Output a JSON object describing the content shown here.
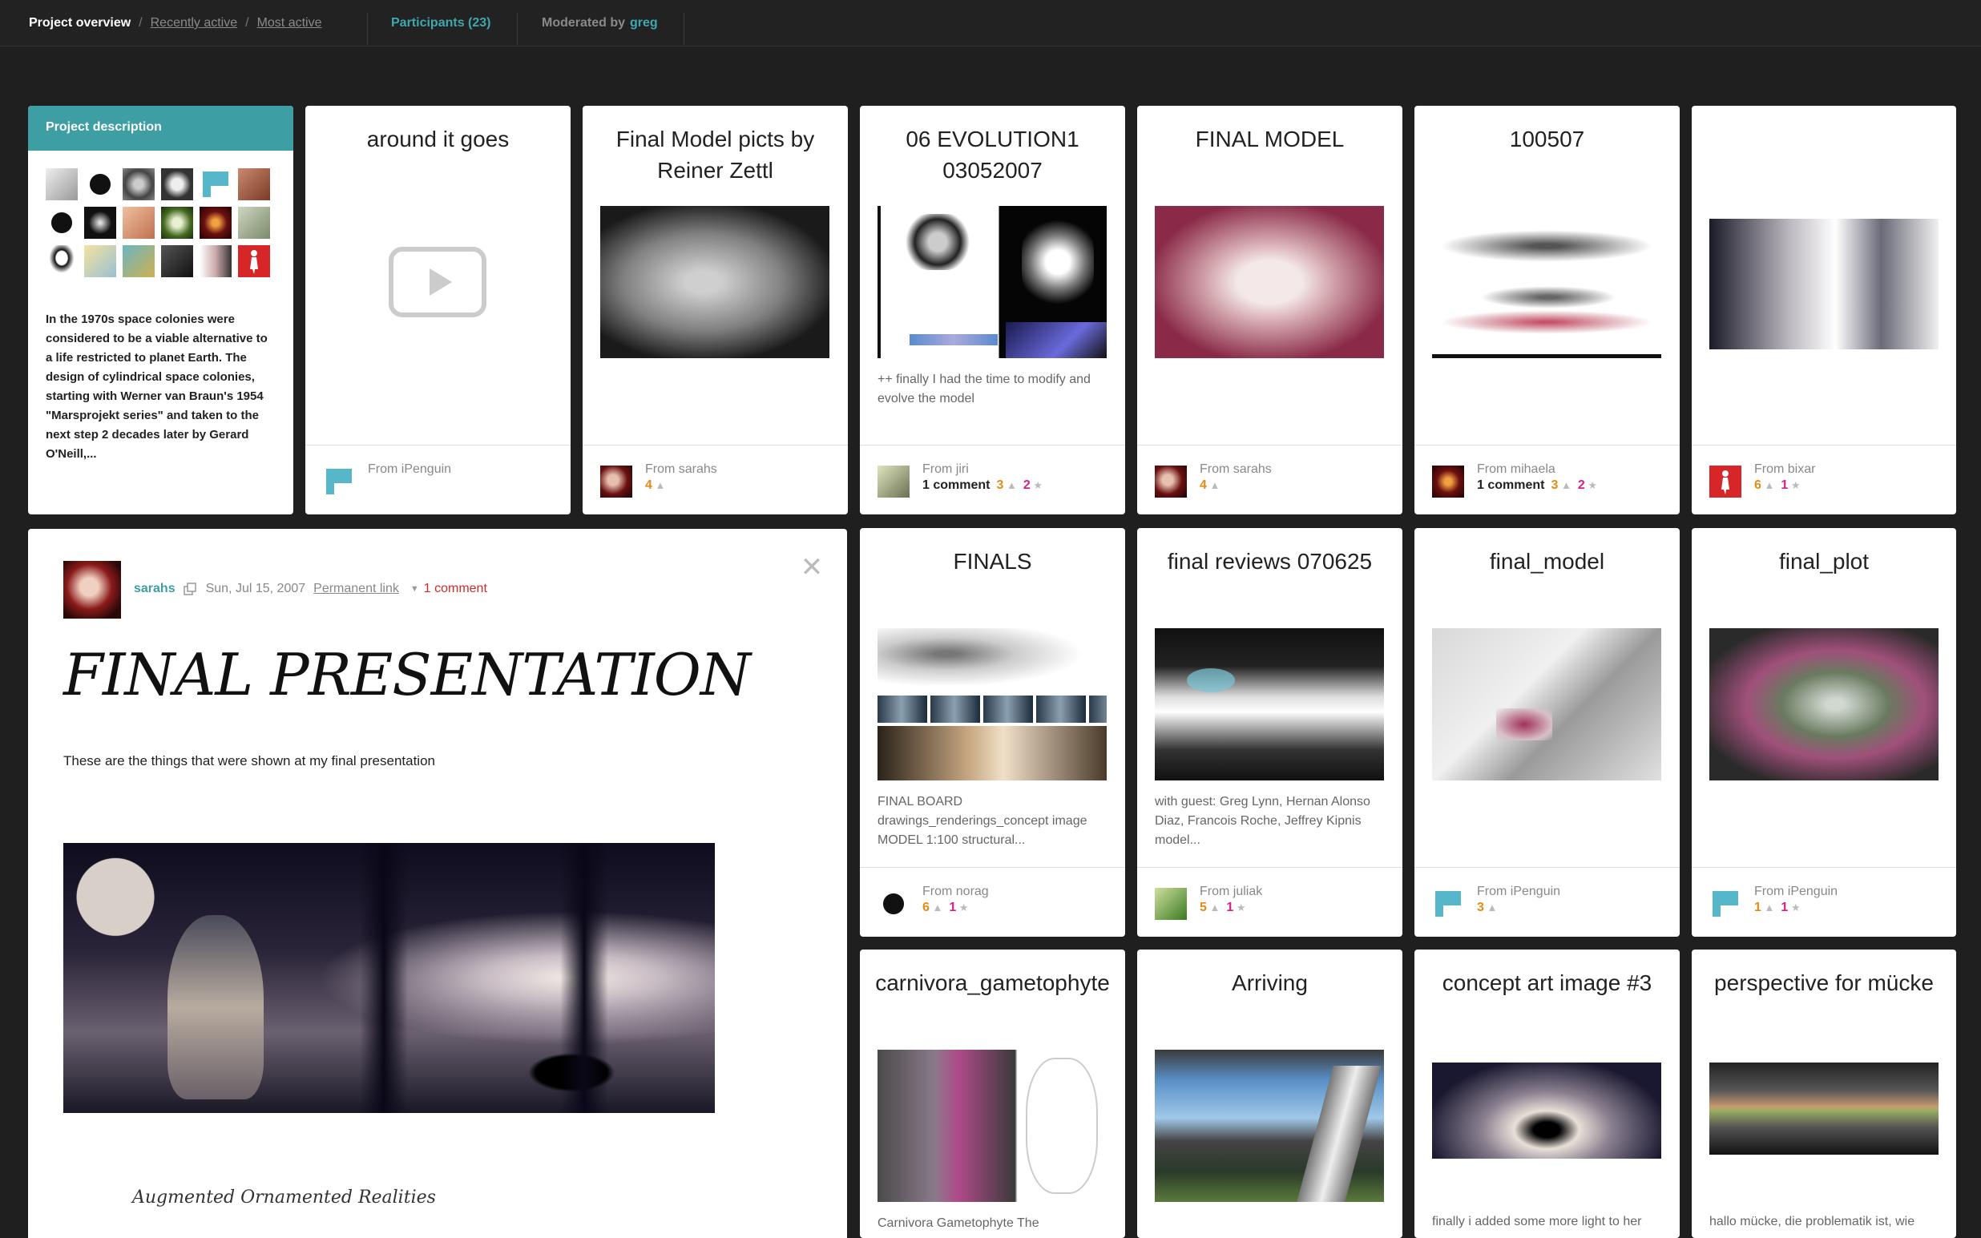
{
  "nav": {
    "project_overview": "Project overview",
    "recently_active": "Recently active",
    "most_active": "Most active",
    "participants": "Participants (23)",
    "moderated_by": "Moderated by",
    "moderator": "greg"
  },
  "project_description": {
    "title": "Project description",
    "text": "In the 1970s space colonies were considered to be a viable alternative to a life restricted to planet Earth. The design of cylindrical space colonies, starting with Werner van Braun's 1954 \"Marsprojekt series\" and taken to the next step 2 decades later by Gerard O'Neill,..."
  },
  "cards": [
    {
      "title": "around it goes",
      "desc": "",
      "from": "From iPenguin",
      "comments": "",
      "up": "",
      "fav": ""
    },
    {
      "title": "Final Model picts by Reiner Zettl",
      "desc": "",
      "from": "From sarahs",
      "comments": "",
      "up": "4",
      "fav": ""
    },
    {
      "title": "06 EVOLUTION1 03052007",
      "desc": "++ finally I had the time to modify and evolve the model",
      "from": "From jiri",
      "comments": "1 comment",
      "up": "3",
      "fav": "2"
    },
    {
      "title": "FINAL MODEL",
      "desc": "",
      "from": "From sarahs",
      "comments": "",
      "up": "4",
      "fav": ""
    },
    {
      "title": "100507",
      "desc": "",
      "from": "From mihaela",
      "comments": "1 comment",
      "up": "3",
      "fav": "2"
    },
    {
      "title": "",
      "desc": "",
      "from": "From bixar",
      "comments": "",
      "up": "6",
      "fav": "1"
    },
    {
      "title": "FINALS",
      "desc": "FINAL BOARD drawings_renderings_concept image MODEL 1:100 structural...",
      "from": "From norag",
      "comments": "",
      "up": "6",
      "fav": "1"
    },
    {
      "title": "final reviews 070625",
      "desc": "with guest: Greg Lynn, Hernan Alonso Diaz, Francois Roche, Jeffrey Kipnis model...",
      "from": "From juliak",
      "comments": "",
      "up": "5",
      "fav": "1"
    },
    {
      "title": "final_model",
      "desc": "",
      "from": "From iPenguin",
      "comments": "",
      "up": "3",
      "fav": ""
    },
    {
      "title": "final_plot",
      "desc": "",
      "from": "From iPenguin",
      "comments": "",
      "up": "1",
      "fav": "1"
    },
    {
      "title": "carnivora_gametophyte",
      "desc": "Carnivora Gametophyte The",
      "from": "",
      "comments": "",
      "up": "",
      "fav": ""
    },
    {
      "title": "Arriving",
      "desc": "",
      "from": "",
      "comments": "",
      "up": "",
      "fav": ""
    },
    {
      "title": "concept art image #3",
      "desc": "finally i added some more light to her",
      "from": "",
      "comments": "",
      "up": "",
      "fav": ""
    },
    {
      "title": "perspective for mücke",
      "desc": "hallo mücke, die problematik ist, wie",
      "from": "",
      "comments": "",
      "up": "",
      "fav": ""
    }
  ],
  "detail": {
    "user": "sarahs",
    "date": "Sun, Jul 15, 2007",
    "permanent_link": "Permanent link",
    "comments": "1 comment",
    "title": "FINAL PRESENTATION",
    "subtitle": "These are the things that were shown at my final presentation",
    "doc_heading": "Augmented Ornamented Realities"
  },
  "icons": {
    "close": "close-icon",
    "play": "play-icon",
    "flag": "flag-icon",
    "copy": "copy-icon",
    "dropdown": "chevron-down-icon"
  },
  "colors": {
    "teal": "#3d9ea3",
    "orange": "#e88a16",
    "magenta": "#d6208b",
    "red": "#d32a2a"
  }
}
